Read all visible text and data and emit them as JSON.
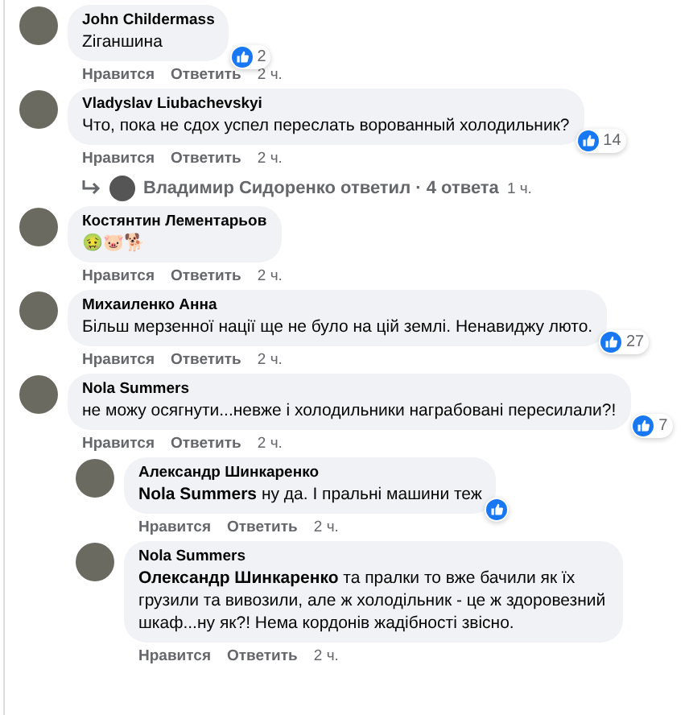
{
  "comments": [
    {
      "author": "John Childermass",
      "text": "Ziганшина",
      "reaction": true,
      "reaction_count": "2",
      "actions": [
        "Нравится",
        "Ответить"
      ],
      "time": "2 ч."
    },
    {
      "author": "Vladyslav Liubachevskyi",
      "text": "Что, пока не сдох успел переслать ворованный холодильник?",
      "reaction": true,
      "reaction_count": "14",
      "actions": [
        "Нравится",
        "Ответить"
      ],
      "time": "2 ч.",
      "replies_summary": {
        "text": "Владимир Сидоренко ответил · 4 ответа",
        "time": "1 ч."
      }
    },
    {
      "author": "Костянтин Лементарьов",
      "text": "🤢🐷🐕",
      "reaction": false,
      "actions": [
        "Нравится",
        "Ответить"
      ],
      "time": "2 ч."
    },
    {
      "author": "Михаиленко Анна",
      "text": "Більш мерзенної нації ще не було на цій землі. Ненавиджу люто.",
      "reaction": true,
      "reaction_count": "27",
      "actions": [
        "Нравится",
        "Ответить"
      ],
      "time": "2 ч."
    },
    {
      "author": "Nola Summers",
      "text": "не можу осягнути...невже і холодильники награбовані пересилали?!",
      "reaction": true,
      "reaction_count": "7",
      "actions": [
        "Нравится",
        "Ответить"
      ],
      "time": "2 ч.",
      "children": [
        {
          "author": "Александр Шинкаренко",
          "text": "**Nola Summers** ну да. І пральні машини теж",
          "reaction": true,
          "actions": [
            "Нравится",
            "Ответить"
          ],
          "time": "2 ч."
        },
        {
          "author": "Nola Summers",
          "text": "**Олександр Шинкаренко** та пралки то вже бачили як їх грузили та вивозили, але ж холодільник - це ж здоровезний шкаф...ну як?! Нема кордонів жадібності звісно.",
          "reaction": false,
          "actions": [
            "Нравится",
            "Ответить"
          ],
          "time": "2 ч."
        }
      ]
    }
  ]
}
